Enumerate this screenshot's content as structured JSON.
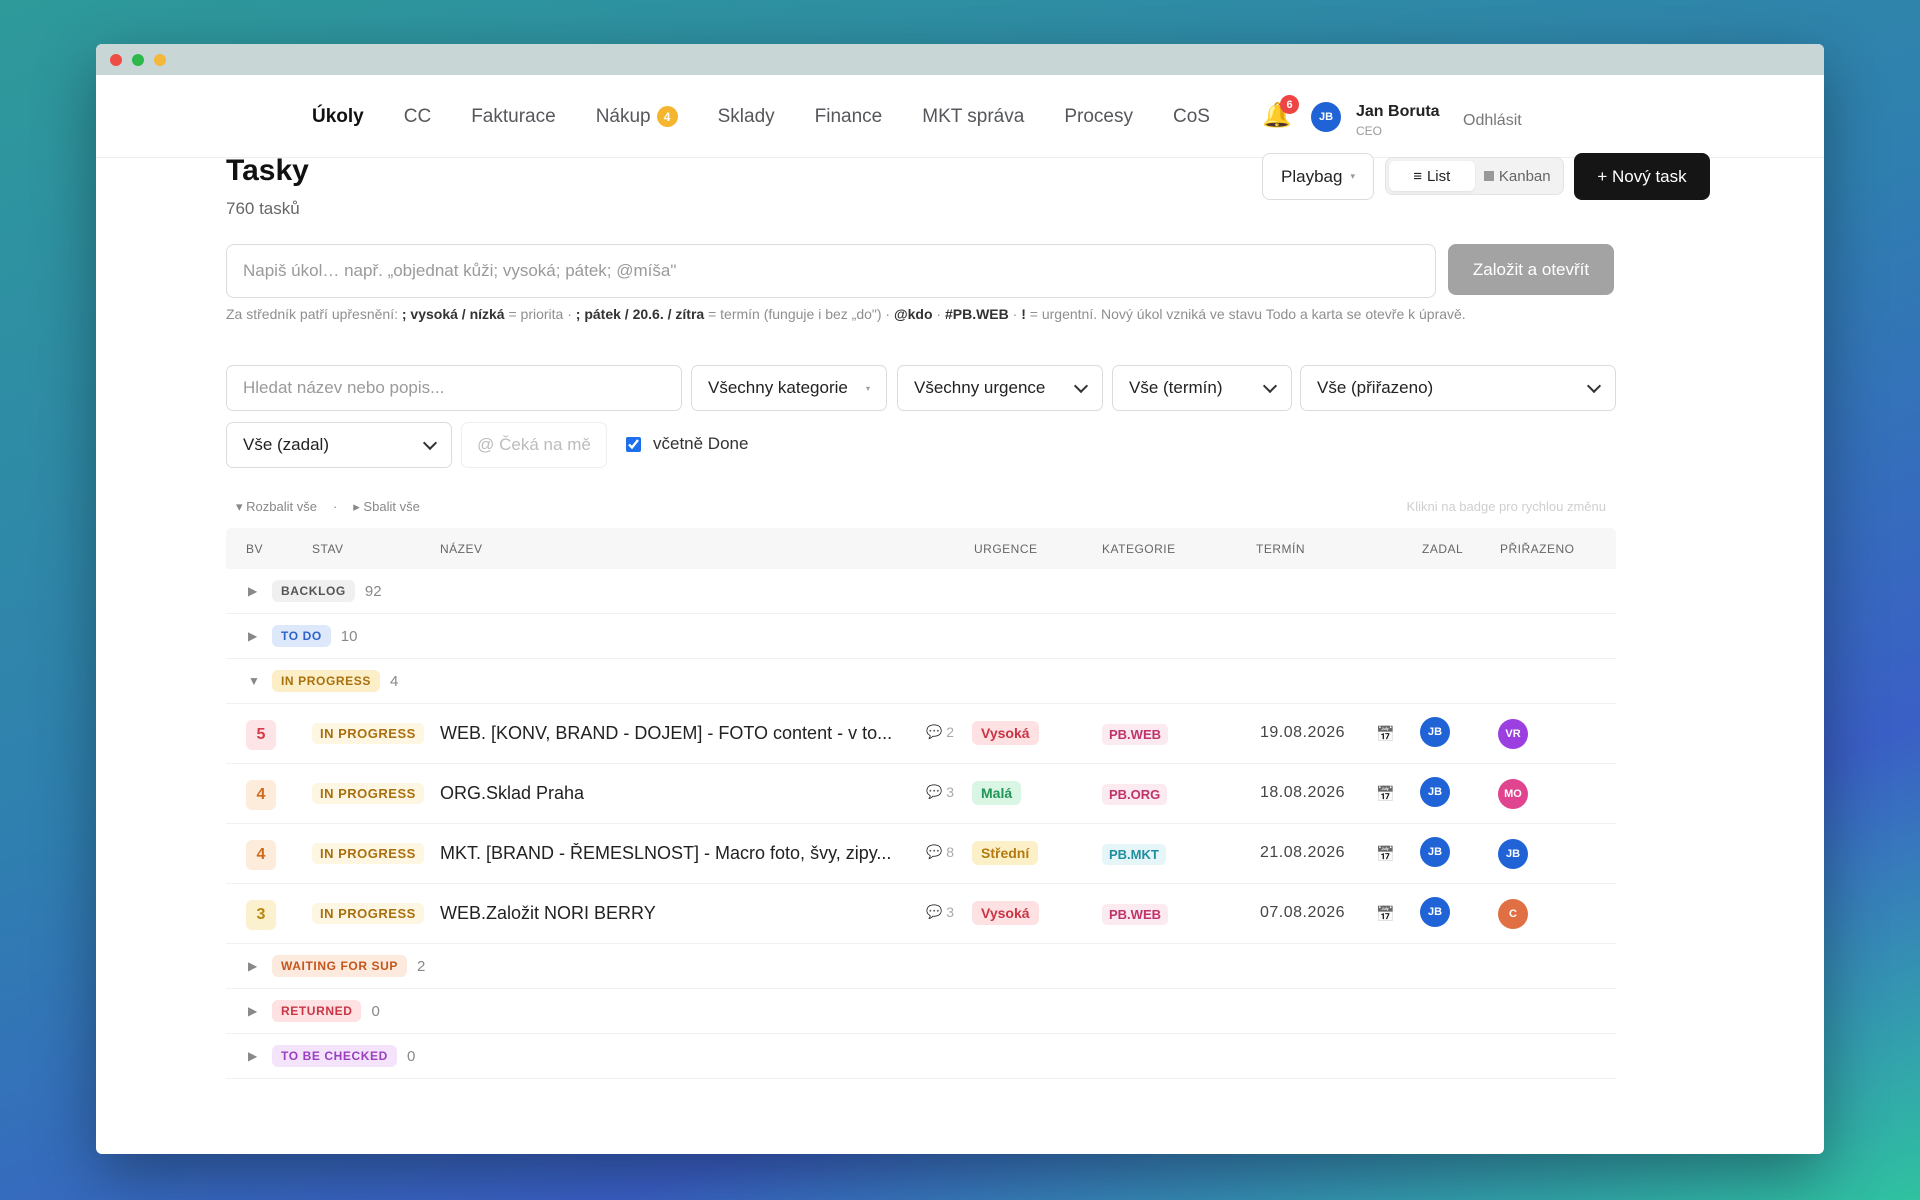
{
  "nav": {
    "items": [
      {
        "label": "Úkoly",
        "active": true,
        "badge": null
      },
      {
        "label": "CC",
        "active": false,
        "badge": null
      },
      {
        "label": "Fakturace",
        "active": false,
        "badge": null
      },
      {
        "label": "Nákup",
        "active": false,
        "badge": "4"
      },
      {
        "label": "Sklady",
        "active": false,
        "badge": null
      },
      {
        "label": "Finance",
        "active": false,
        "badge": null
      },
      {
        "label": "MKT správa",
        "active": false,
        "badge": null
      },
      {
        "label": "Procesy",
        "active": false,
        "badge": null
      },
      {
        "label": "CoS",
        "active": false,
        "badge": null
      }
    ],
    "notification_count": "6",
    "user": {
      "initials": "JB",
      "name": "Jan Boruta",
      "role": "CEO"
    },
    "logout_label": "Odhlásit"
  },
  "header": {
    "title": "Tasky",
    "count": "760 tasků",
    "workspace_label": "Playbag",
    "view_list": "List",
    "view_kanban": "Kanban",
    "new_task_label": "+ Nový task"
  },
  "quick_create": {
    "placeholder": "Napiš úkol… např. „objednat kůži; vysoká; pátek; @míša\"",
    "button_label": "Založit a otevřít",
    "hint_parts": {
      "p1": "Za středník patří upřesnění: ",
      "b1": "; vysoká / nízká",
      "p2": " = priorita · ",
      "b2": "; pátek / 20.6. / zítra",
      "p3": " = termín (funguje i bez „do\") · ",
      "b3": "@kdo",
      "p4": " · ",
      "b4": "#PB.WEB",
      "p5": " · ",
      "b5": "!",
      "p6": " = urgentní. Nový úkol vzniká ve stavu Todo a karta se otevře k úpravě."
    }
  },
  "filters": {
    "search_placeholder": "Hledat název nebo popis...",
    "category": "Všechny kategorie",
    "urgency": "Všechny urgence",
    "deadline": "Vše (termín)",
    "assigned": "Vše (přiřazeno)",
    "assigner": "Vše (zadal)",
    "waiting": "@ Čeká na mě",
    "include_done_label": "včetně Done",
    "include_done_checked": true
  },
  "list_controls": {
    "expand_all": "▾ Rozbalit vše",
    "separator": "·",
    "collapse_all": "▸ Sbalit vše",
    "badge_hint": "Klikni na badge pro rychlou změnu"
  },
  "table": {
    "columns": {
      "bv": "BV",
      "stav": "STAV",
      "nazev": "NÁZEV",
      "urgence": "URGENCE",
      "kategorie": "KATEGORIE",
      "termin": "TERMÍN",
      "zadal": "ZADAL",
      "prirazeno": "PŘIŘAZENO"
    },
    "groups_before": [
      {
        "status": "BACKLOG",
        "count": "92",
        "bg": "#f0f0f0",
        "fg": "#555555"
      },
      {
        "status": "TO DO",
        "count": "10",
        "bg": "#dde9fb",
        "fg": "#2f63c8"
      }
    ],
    "open_group": {
      "status": "IN PROGRESS",
      "count": "4",
      "bg": "#fcefc7",
      "fg": "#a8700f"
    },
    "tasks": [
      {
        "bv": "5",
        "bv_bg": "#fde4e6",
        "bv_fg": "#d63b4a",
        "status": "IN PROGRESS",
        "name": "WEB. [KONV, BRAND - DOJEM] - FOTO content - v to...",
        "comments": "2",
        "urgency": "Vysoká",
        "urg_bg": "#fde1e3",
        "urg_fg": "#c93545",
        "category": "PB.WEB",
        "cat_bg": "#fbeaf0",
        "cat_fg": "#c0336a",
        "date": "19.08.2026",
        "assigner": "JB",
        "assigner_color": "#1f63d6",
        "assignee": "VR",
        "assignee_color": "#9b3fe0"
      },
      {
        "bv": "4",
        "bv_bg": "#fdecdc",
        "bv_fg": "#d26a1d",
        "status": "IN PROGRESS",
        "name": "ORG.Sklad Praha",
        "comments": "3",
        "urgency": "Malá",
        "urg_bg": "#d9f5e3",
        "urg_fg": "#239457",
        "category": "PB.ORG",
        "cat_bg": "#fbeaf0",
        "cat_fg": "#c0336a",
        "date": "18.08.2026",
        "assigner": "JB",
        "assigner_color": "#1f63d6",
        "assignee": "MO",
        "assignee_color": "#e0448f"
      },
      {
        "bv": "4",
        "bv_bg": "#fdecdc",
        "bv_fg": "#d26a1d",
        "status": "IN PROGRESS",
        "name": "MKT. [BRAND - ŘEMESLNOST] - Macro foto, švy, zipy...",
        "comments": "8",
        "urgency": "Střední",
        "urg_bg": "#fcf0c9",
        "urg_fg": "#b27a10",
        "category": "PB.MKT",
        "cat_bg": "#e6f6f8",
        "cat_fg": "#1f8fa0",
        "date": "21.08.2026",
        "assigner": "JB",
        "assigner_color": "#1f63d6",
        "assignee": "JB",
        "assignee_color": "#1f63d6"
      },
      {
        "bv": "3",
        "bv_bg": "#fcf1cf",
        "bv_fg": "#b8860b",
        "status": "IN PROGRESS",
        "name": "WEB.Založit NORI BERRY",
        "comments": "3",
        "urgency": "Vysoká",
        "urg_bg": "#fde1e3",
        "urg_fg": "#c93545",
        "category": "PB.WEB",
        "cat_bg": "#fbeaf0",
        "cat_fg": "#c0336a",
        "date": "07.08.2026",
        "assigner": "JB",
        "assigner_color": "#1f63d6",
        "assignee": "C",
        "assignee_color": "#e07044"
      }
    ],
    "groups_after": [
      {
        "status": "WAITING FOR SUP",
        "count": "2",
        "bg": "#fdeadf",
        "fg": "#c4561a"
      },
      {
        "status": "RETURNED",
        "count": "0",
        "bg": "#fde1e3",
        "fg": "#c93545"
      },
      {
        "status": "TO BE CHECKED",
        "count": "0",
        "bg": "#f3e3fb",
        "fg": "#9b3fc0"
      }
    ]
  }
}
